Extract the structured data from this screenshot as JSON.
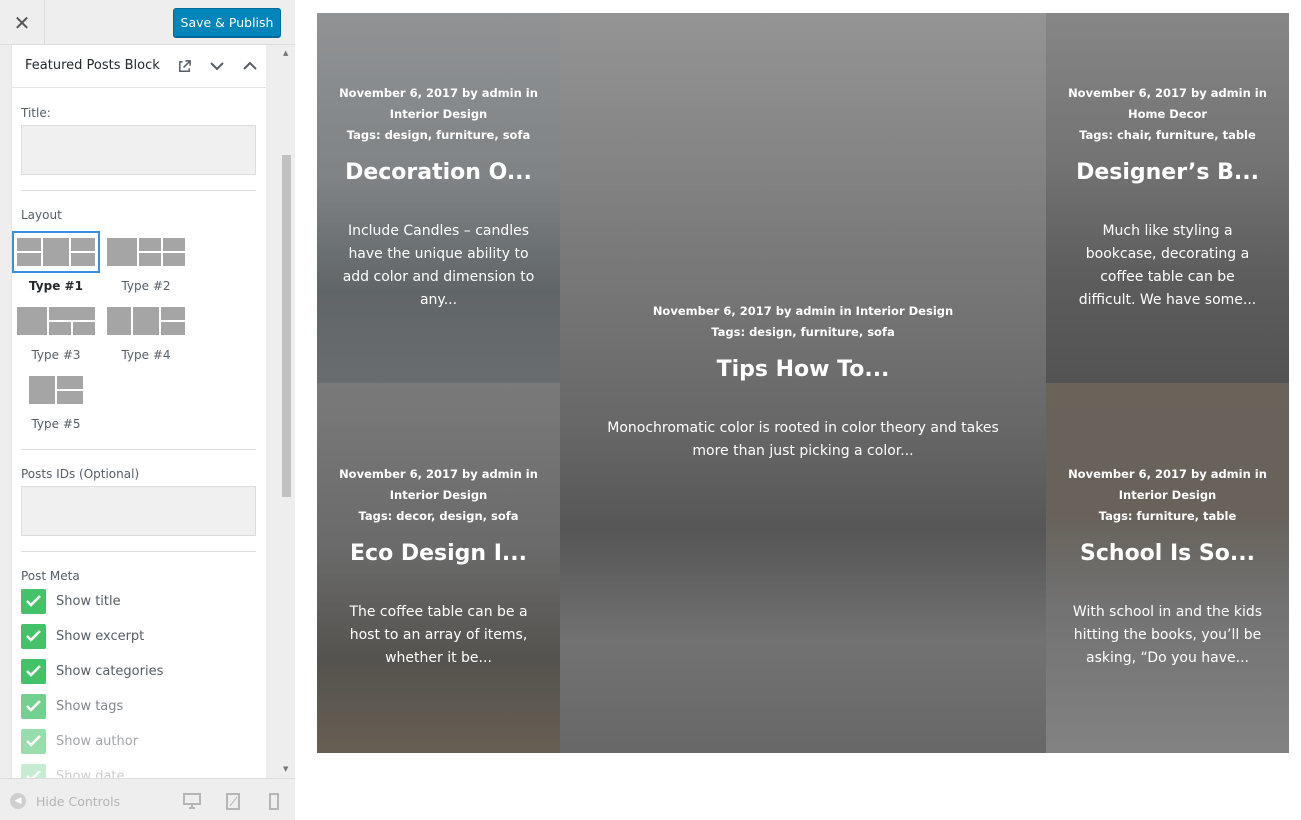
{
  "topbar": {
    "close_icon": "close-icon",
    "save_label": "Save & Publish"
  },
  "panel": {
    "title": "Featured Posts Block",
    "title_label": "Title:",
    "title_value": "",
    "layout_label": "Layout",
    "layouts": [
      {
        "label": "Type #1",
        "selected": true
      },
      {
        "label": "Type #2",
        "selected": false
      },
      {
        "label": "Type #3",
        "selected": false
      },
      {
        "label": "Type #4",
        "selected": false
      },
      {
        "label": "Type #5",
        "selected": false
      }
    ],
    "post_ids_label": "Posts IDs (Optional)",
    "post_ids_value": "",
    "post_meta_label": "Post Meta",
    "meta_options": [
      {
        "label": "Show title",
        "checked": true
      },
      {
        "label": "Show excerpt",
        "checked": true
      },
      {
        "label": "Show categories",
        "checked": true
      },
      {
        "label": "Show tags",
        "checked": true
      },
      {
        "label": "Show author",
        "checked": true
      },
      {
        "label": "Show date",
        "checked": true
      }
    ]
  },
  "bottombar": {
    "hide_controls": "Hide Controls"
  },
  "accent_color": "#0085ba",
  "check_color": "#44c26a",
  "posts": [
    {
      "date_author": "November 6, 2017 by admin in",
      "category": "Interior Design",
      "tags": "Tags: design, furniture, sofa",
      "title": "Decoration O...",
      "excerpt": "Include Candles – candles have the unique ability to add color and dimension to any..."
    },
    {
      "date_author": "November 6, 2017 by admin in Interior Design",
      "category": "",
      "tags": "Tags: design, furniture, sofa",
      "title": "Tips How To...",
      "excerpt": "Monochromatic color is rooted in color theory and takes more than just picking a color..."
    },
    {
      "date_author": "November 6, 2017 by admin in",
      "category": "Home Decor",
      "tags": "Tags: chair, furniture, table",
      "title": "Designer’s B...",
      "excerpt": "Much like styling a bookcase, decorating a coffee table can be difficult. We have some..."
    },
    {
      "date_author": "November 6, 2017 by admin in",
      "category": "Interior Design",
      "tags": "Tags: decor, design, sofa",
      "title": "Eco Design I...",
      "excerpt": "The coffee table can be a host to an array of items, whether it be..."
    },
    {
      "date_author": "November 6, 2017 by admin in",
      "category": "Interior Design",
      "tags": "Tags: furniture, table",
      "title": "School Is So...",
      "excerpt": "With school in and the kids hitting the books, you’ll be asking, “Do you have..."
    }
  ]
}
